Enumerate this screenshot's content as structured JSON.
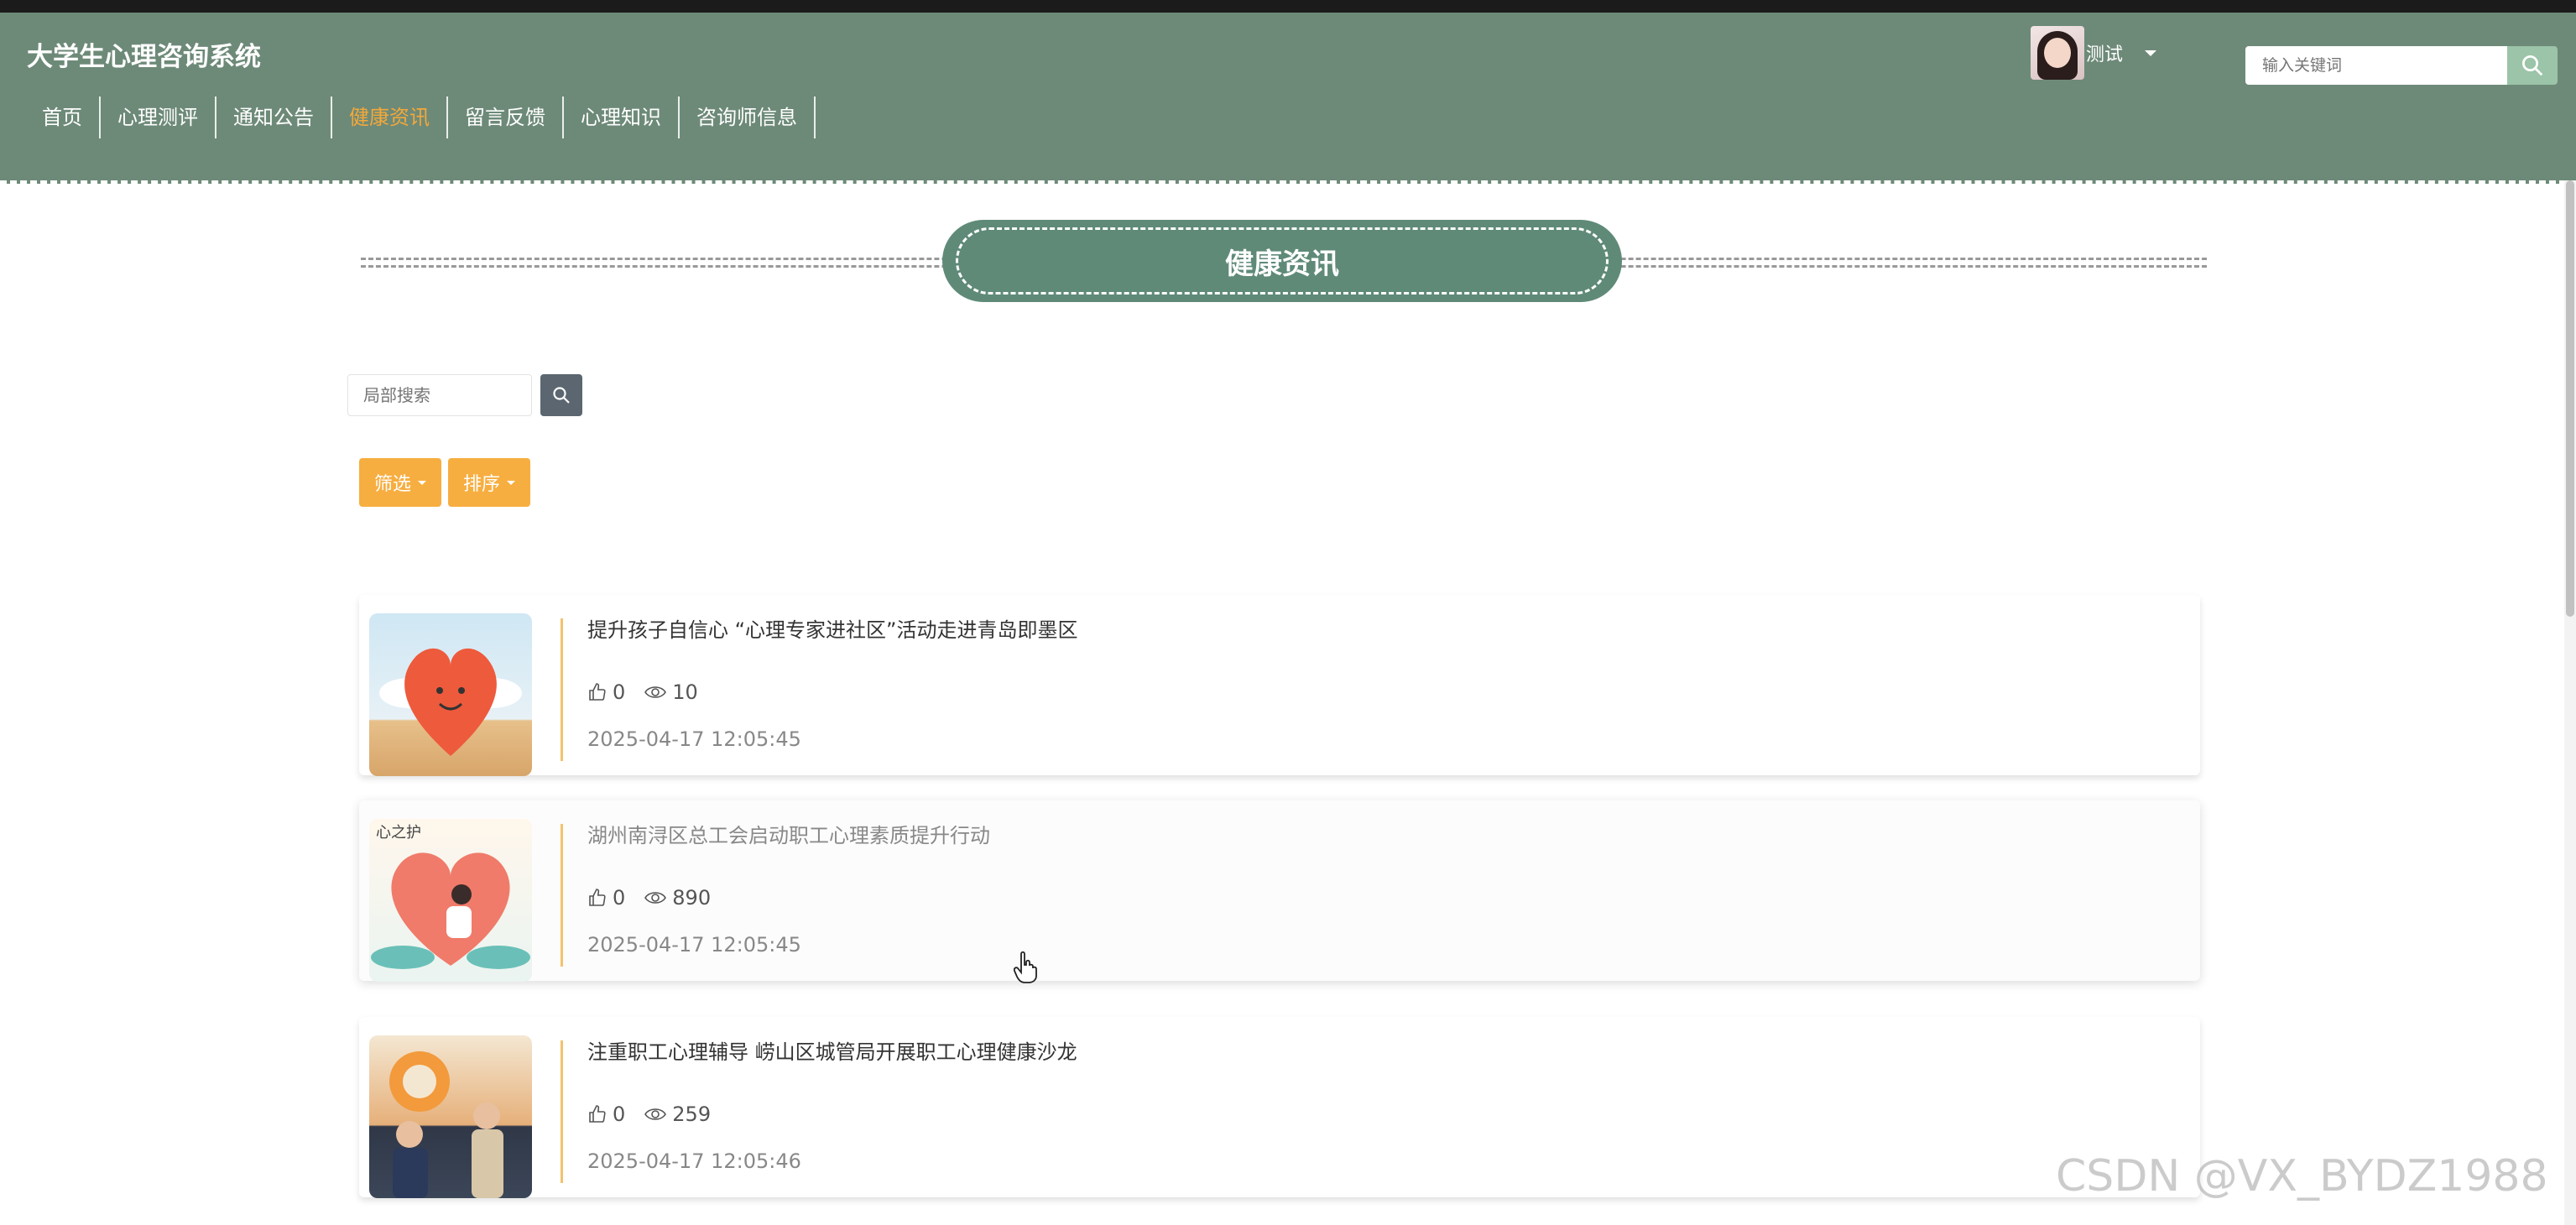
{
  "site": {
    "title": "大学生心理咨询系统"
  },
  "nav": {
    "items": [
      {
        "label": "首页"
      },
      {
        "label": "心理测评"
      },
      {
        "label": "通知公告"
      },
      {
        "label": "健康资讯",
        "active": true
      },
      {
        "label": "留言反馈"
      },
      {
        "label": "心理知识"
      },
      {
        "label": "咨询师信息"
      }
    ]
  },
  "user": {
    "name": "测试"
  },
  "top_search": {
    "placeholder": "输入关键词"
  },
  "page": {
    "title": "健康资讯"
  },
  "local_search": {
    "placeholder": "局部搜索"
  },
  "filters": {
    "filter_label": "筛选",
    "sort_label": "排序"
  },
  "articles": [
    {
      "title": "提升孩子自信心 “心理专家进社区”活动走进青岛即墨区",
      "likes": "0",
      "views": "10",
      "date": "2025-04-17 12:05:45"
    },
    {
      "title": "湖州南浔区总工会启动职工心理素质提升行动",
      "likes": "0",
      "views": "890",
      "date": "2025-04-17 12:05:45"
    },
    {
      "title": "注重职工心理辅导 崂山区城管局开展职工心理健康沙龙",
      "likes": "0",
      "views": "259",
      "date": "2025-04-17 12:05:46"
    }
  ],
  "watermark": "CSDN @VX_BYDZ1988",
  "colors": {
    "header": "#6d8a78",
    "accent": "#f3a83a",
    "pill": "#5f8a78",
    "button": "#f7ae40"
  }
}
